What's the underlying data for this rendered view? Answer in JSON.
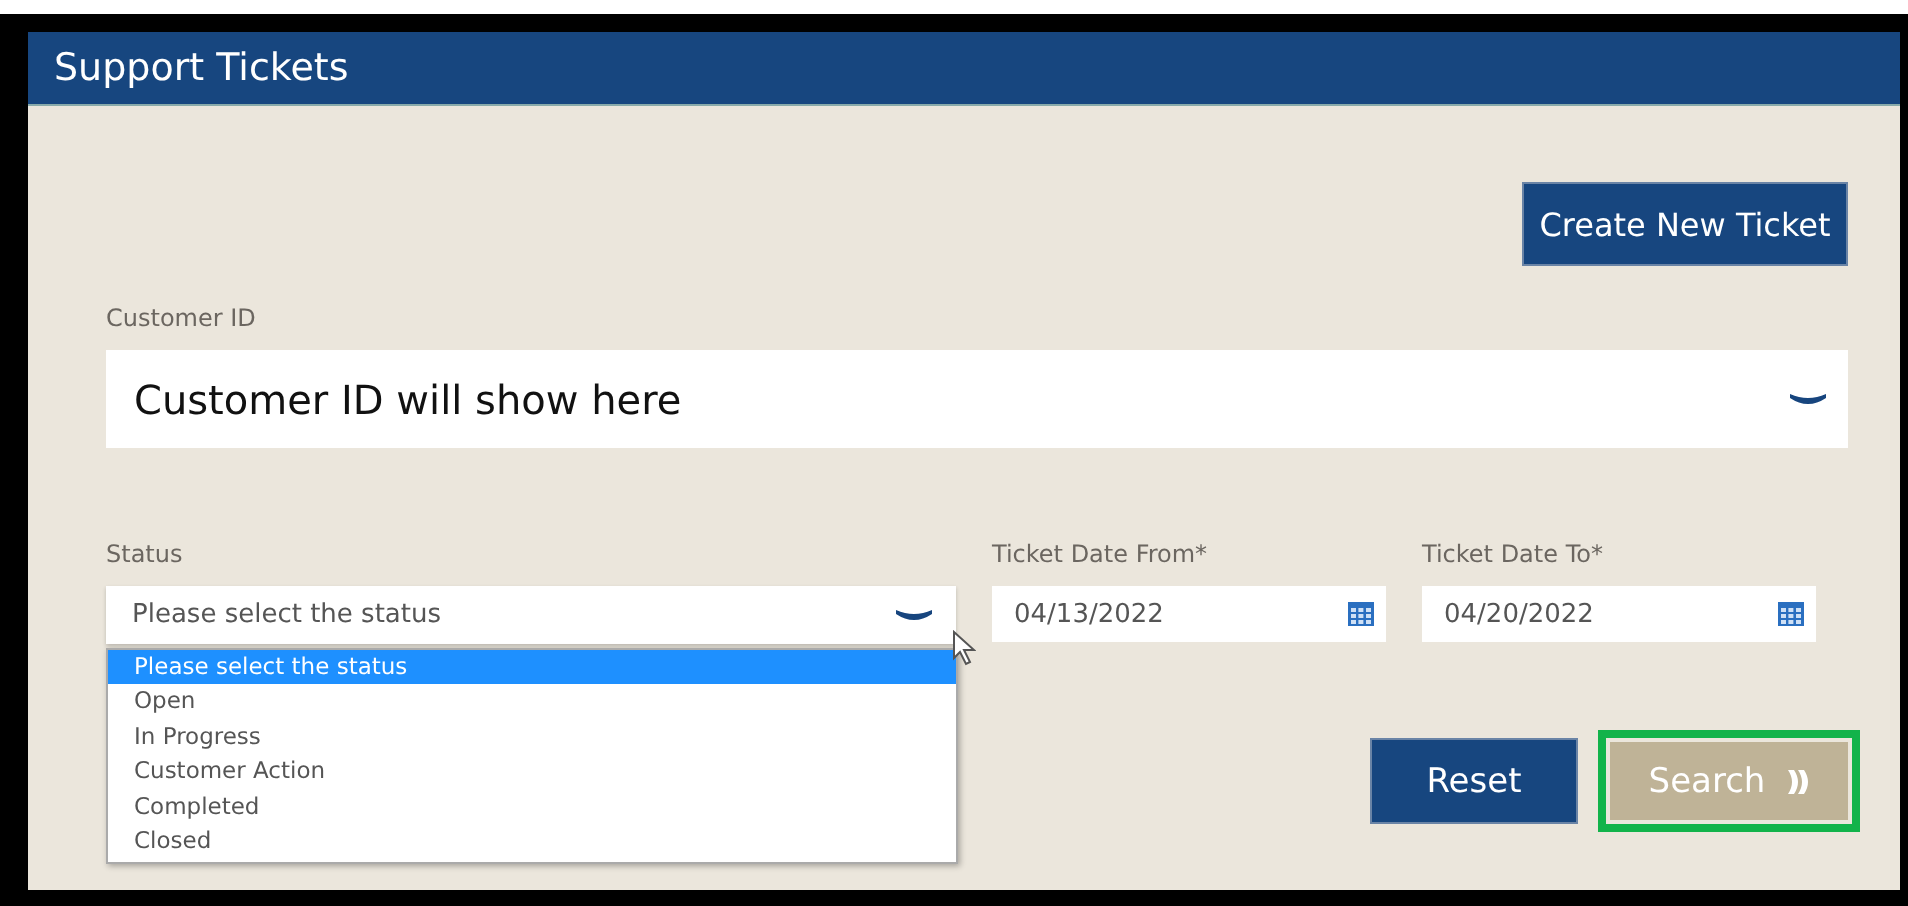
{
  "header": {
    "title": "Support Tickets"
  },
  "create_button": {
    "label": "Create New Ticket"
  },
  "customer": {
    "label": "Customer ID",
    "value": "Customer ID will show here"
  },
  "status": {
    "label": "Status",
    "value": "Please select the status",
    "expanded": true,
    "options": [
      {
        "label": "Please select the status",
        "selected": true
      },
      {
        "label": "Open",
        "selected": false
      },
      {
        "label": "In Progress",
        "selected": false
      },
      {
        "label": "Customer Action",
        "selected": false
      },
      {
        "label": "Completed",
        "selected": false
      },
      {
        "label": "Closed",
        "selected": false
      }
    ]
  },
  "date_from": {
    "label": "Ticket Date From*",
    "value": "04/13/2022"
  },
  "date_to": {
    "label": "Ticket Date To*",
    "value": "04/20/2022"
  },
  "buttons": [
    {
      "kind": "primary",
      "label": "Reset",
      "highlighted": false
    },
    {
      "kind": "secondary",
      "label": "Search",
      "highlighted": true
    }
  ]
}
